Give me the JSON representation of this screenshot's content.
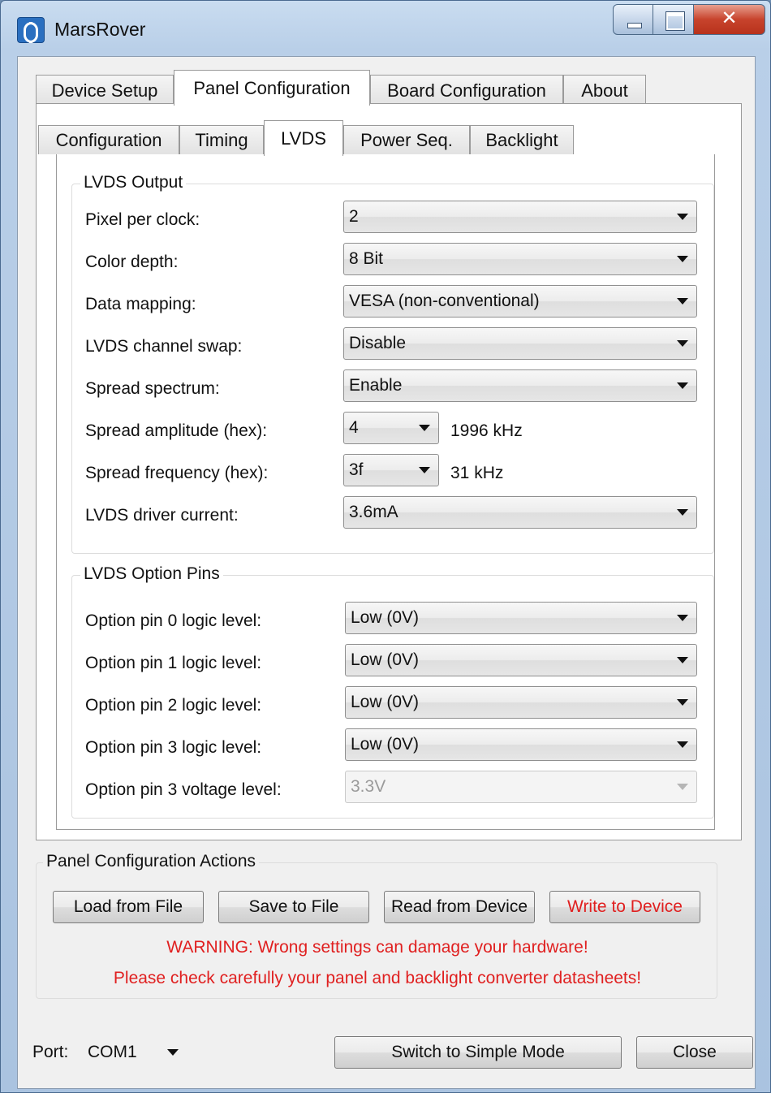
{
  "window": {
    "title": "MarsRover"
  },
  "main_tabs": [
    "Device Setup",
    "Panel Configuration",
    "Board Configuration",
    "About"
  ],
  "sub_tabs": [
    "Configuration",
    "Timing",
    "LVDS",
    "Power Seq.",
    "Backlight"
  ],
  "lvds_output": {
    "title": "LVDS Output",
    "rows": [
      {
        "label": "Pixel per clock:",
        "value": "2"
      },
      {
        "label": "Color depth:",
        "value": "8 Bit"
      },
      {
        "label": "Data mapping:",
        "value": "VESA (non-conventional)"
      },
      {
        "label": "LVDS channel swap:",
        "value": "Disable"
      },
      {
        "label": "Spread spectrum:",
        "value": "Enable"
      },
      {
        "label": "Spread amplitude (hex):",
        "value": "4",
        "extra": "1996 kHz"
      },
      {
        "label": "Spread frequency (hex):",
        "value": "3f",
        "extra": "31 kHz"
      },
      {
        "label": "LVDS driver current:",
        "value": "3.6mA"
      }
    ]
  },
  "lvds_option_pins": {
    "title": "LVDS Option Pins",
    "rows": [
      {
        "label": "Option pin 0 logic level:",
        "value": "Low (0V)"
      },
      {
        "label": "Option pin 1 logic level:",
        "value": "Low (0V)"
      },
      {
        "label": "Option pin 2 logic level:",
        "value": "Low (0V)"
      },
      {
        "label": "Option pin 3 logic level:",
        "value": "Low (0V)"
      },
      {
        "label": "Option pin 3 voltage level:",
        "value": "3.3V"
      }
    ]
  },
  "actions": {
    "title": "Panel Configuration Actions",
    "load": "Load from File",
    "save": "Save to File",
    "read": "Read from Device",
    "write": "Write to Device",
    "warning1": "WARNING: Wrong settings can damage your hardware!",
    "warning2": "Please check carefully your panel and backlight converter datasheets!"
  },
  "footer": {
    "port_label": "Port:",
    "port_value": "COM1",
    "switch_mode": "Switch to Simple Mode",
    "close": "Close"
  },
  "colors": {
    "warning": "#e02020",
    "titlebar": "#b9cfe8",
    "close_button": "#c7432c"
  }
}
